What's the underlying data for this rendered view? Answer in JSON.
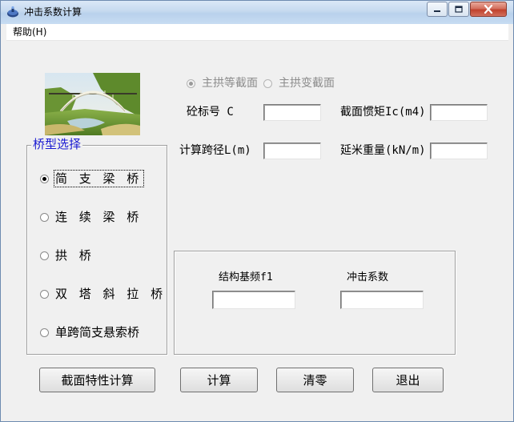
{
  "window": {
    "title": "冲击系数计算"
  },
  "titlebar_buttons": {
    "minimize_icon": "minimize-icon",
    "maximize_icon": "maximize-icon",
    "close_icon": "close-icon"
  },
  "menu": {
    "items": [
      "帮助(H)"
    ]
  },
  "section_type": {
    "options": [
      {
        "label": "主拱等截面",
        "checked": true
      },
      {
        "label": "主拱变截面",
        "checked": false
      }
    ]
  },
  "inputs": {
    "concrete_grade": {
      "label": "砼标号 C",
      "value": ""
    },
    "inertia_moment": {
      "label": "截面惯矩Ic(m4)",
      "value": ""
    },
    "span_length": {
      "label": "计算跨径L(m)",
      "value": ""
    },
    "unit_weight": {
      "label": "延米重量(kN/m)",
      "value": ""
    }
  },
  "bridge_type": {
    "legend": "桥型选择",
    "options": [
      {
        "label": "简 支 梁 桥",
        "checked": true
      },
      {
        "label": "连 续 梁 桥",
        "checked": false
      },
      {
        "label": "拱 桥",
        "checked": false
      },
      {
        "label": "双 塔 斜 拉 桥",
        "checked": false
      },
      {
        "label": "单跨简支悬索桥",
        "checked": false
      }
    ]
  },
  "results": {
    "frequency": {
      "label": "结构基频f1",
      "value": ""
    },
    "impact_factor": {
      "label": "冲击系数",
      "value": ""
    }
  },
  "buttons": {
    "section_calc": "截面特性计算",
    "calculate": "计算",
    "clear": "清零",
    "exit": "退出"
  },
  "colors": {
    "legend_text": "#1a1ad2",
    "titlebar": "#c5d9ef",
    "close_button": "#c0412c",
    "disabled_text": "#8c8c8c"
  }
}
